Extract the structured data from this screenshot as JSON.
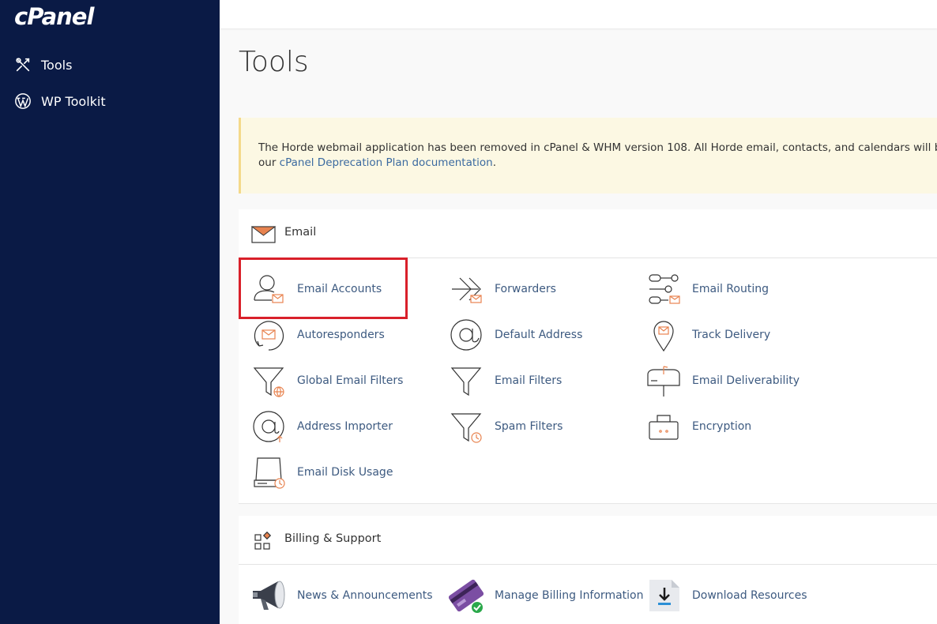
{
  "brand": {
    "logo_text": "cPanel"
  },
  "sidebar": {
    "items": [
      {
        "label": "Tools",
        "icon": "tools-icon"
      },
      {
        "label": "WP Toolkit",
        "icon": "wordpress-icon"
      }
    ]
  },
  "page": {
    "title": "Tools"
  },
  "alert": {
    "line1": "The Horde webmail application has been removed in cPanel & WHM version 108. All Horde email, contacts, and calendars will be aut",
    "line2_prefix": "our ",
    "link_text": "cPanel Deprecation Plan documentation",
    "line2_suffix": "."
  },
  "email_section": {
    "title": "Email",
    "items": [
      {
        "label": "Email Accounts",
        "icon": "email-accounts-icon"
      },
      {
        "label": "Forwarders",
        "icon": "forwarders-icon"
      },
      {
        "label": "Email Routing",
        "icon": "email-routing-icon"
      },
      {
        "label": "Autoresponders",
        "icon": "autoresponders-icon"
      },
      {
        "label": "Default Address",
        "icon": "default-address-icon"
      },
      {
        "label": "Track Delivery",
        "icon": "track-delivery-icon"
      },
      {
        "label": "Global Email Filters",
        "icon": "global-email-filters-icon"
      },
      {
        "label": "Email Filters",
        "icon": "email-filters-icon"
      },
      {
        "label": "Email Deliverability",
        "icon": "email-deliverability-icon"
      },
      {
        "label": "Address Importer",
        "icon": "address-importer-icon"
      },
      {
        "label": "Spam Filters",
        "icon": "spam-filters-icon"
      },
      {
        "label": "Encryption",
        "icon": "encryption-icon"
      },
      {
        "label": "Email Disk Usage",
        "icon": "email-disk-usage-icon"
      }
    ]
  },
  "billing_section": {
    "title": "Billing & Support",
    "items": [
      {
        "label": "News & Announcements",
        "icon": "megaphone-icon"
      },
      {
        "label": "Manage Billing Information",
        "icon": "credit-card-icon"
      },
      {
        "label": "Download Resources",
        "icon": "download-icon"
      }
    ]
  },
  "colors": {
    "sidebar_bg": "#0a1a45",
    "accent_orange": "#e8834f",
    "link_blue": "#3d5a80",
    "highlight_red": "#d9202a",
    "alert_bg": "#fcf8e3"
  }
}
